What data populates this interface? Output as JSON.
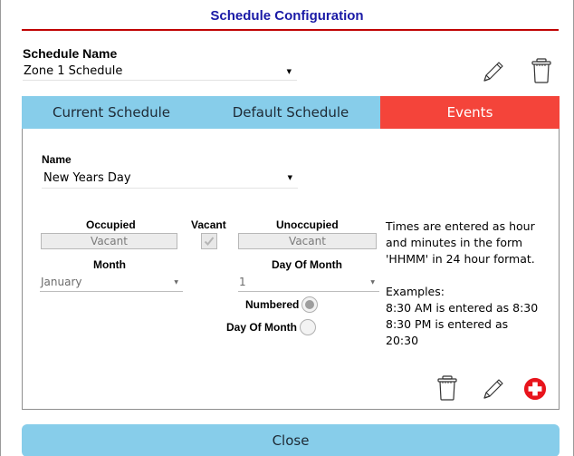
{
  "dialog": {
    "title": "Schedule Configuration"
  },
  "schedule": {
    "label": "Schedule Name",
    "selected": "Zone 1 Schedule"
  },
  "tabs": [
    {
      "label": "Current Schedule",
      "active": false
    },
    {
      "label": "Default Schedule",
      "active": false
    },
    {
      "label": "Events",
      "active": true
    }
  ],
  "event": {
    "name_label": "Name",
    "name_selected": "New Years Day",
    "occupied_label": "Occupied",
    "occupied_value": "Vacant",
    "vacant_label": "Vacant",
    "vacant_checked": true,
    "unoccupied_label": "Unoccupied",
    "unoccupied_value": "Vacant",
    "month_label": "Month",
    "month_selected": "January",
    "dom_label": "Day Of Month",
    "dom_selected": "1",
    "radio_numbered": "Numbered",
    "radio_dom": "Day Of Month",
    "numbered_selected": true
  },
  "help": {
    "lines": [
      "Times are entered as hour",
      "and minutes in the form",
      "'HHMM' in 24 hour format.",
      "",
      "Examples:",
      "8:30 AM is entered as 8:30",
      "8:30 PM is entered as",
      "20:30"
    ]
  },
  "footer": {
    "close_label": "Close"
  },
  "colors": {
    "accent_blue": "#87cdea",
    "accent_red": "#f4443a",
    "title_blue": "#1a1aa6",
    "rule_red": "#c00000"
  },
  "icons": [
    "pencil-icon",
    "trash-icon",
    "plus-icon"
  ]
}
